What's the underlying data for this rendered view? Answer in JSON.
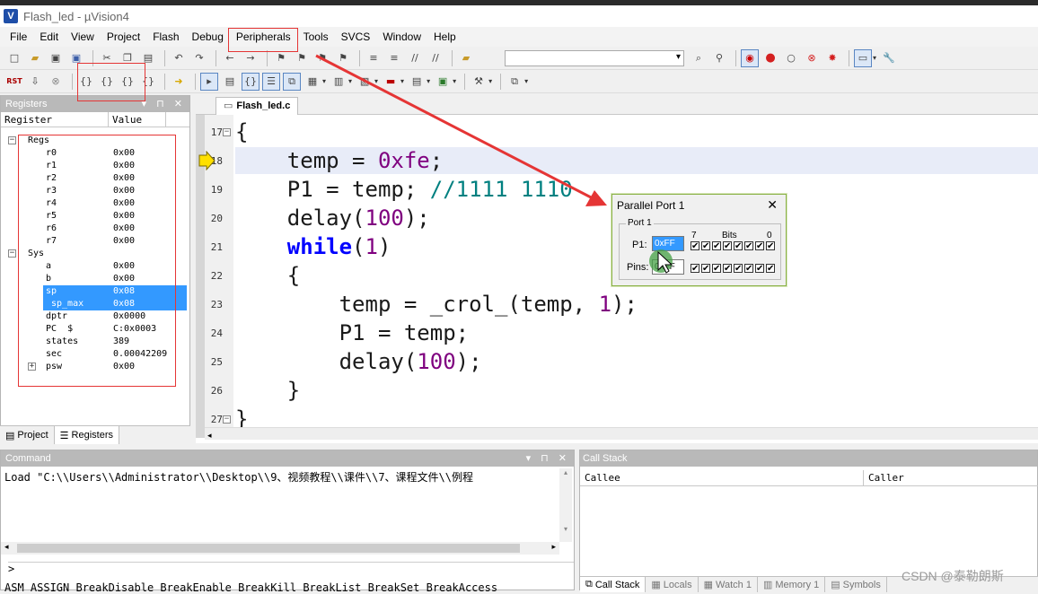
{
  "window": {
    "title": "Flash_led  -  µVision4",
    "app_icon_letter": "V"
  },
  "menu": [
    "File",
    "Edit",
    "View",
    "Project",
    "Flash",
    "Debug",
    "Peripherals",
    "Tools",
    "SVCS",
    "Window",
    "Help"
  ],
  "debug_toolbar": {
    "rst_label": "RST",
    "step_buttons": [
      "{}",
      "{}",
      "{}",
      "{}"
    ]
  },
  "registers_panel": {
    "title": "Registers",
    "columns": [
      "Register",
      "Value"
    ],
    "groups": [
      {
        "name": "Regs",
        "rows": [
          [
            "r0",
            "0x00"
          ],
          [
            "r1",
            "0x00"
          ],
          [
            "r2",
            "0x00"
          ],
          [
            "r3",
            "0x00"
          ],
          [
            "r4",
            "0x00"
          ],
          [
            "r5",
            "0x00"
          ],
          [
            "r6",
            "0x00"
          ],
          [
            "r7",
            "0x00"
          ]
        ]
      },
      {
        "name": "Sys",
        "rows": [
          [
            "a",
            "0x00"
          ],
          [
            "b",
            "0x00"
          ],
          [
            "sp",
            "0x08"
          ],
          [
            "sp_max",
            "0x08"
          ],
          [
            "dptr",
            "0x0000"
          ],
          [
            "PC  $",
            "C:0x0003"
          ],
          [
            "states",
            "389"
          ],
          [
            "sec",
            "0.00042209"
          ],
          [
            "psw",
            "0x00"
          ]
        ]
      }
    ],
    "selected": [
      "sp",
      "sp_max"
    ],
    "tabs": [
      "Project",
      "Registers"
    ],
    "active_tab": "Registers"
  },
  "editor": {
    "tab": "Flash_led.c",
    "current_line": 18,
    "lines": [
      {
        "n": "17",
        "code": "{"
      },
      {
        "n": "18",
        "code": "temp = 0xfe;"
      },
      {
        "n": "19",
        "code": "P1 = temp; //1111 1110"
      },
      {
        "n": "20",
        "code": "delay(100);"
      },
      {
        "n": "21",
        "code": "while(1)"
      },
      {
        "n": "22",
        "code": "{"
      },
      {
        "n": "23",
        "code": "temp = _crol_(temp, 1);"
      },
      {
        "n": "24",
        "code": "P1 = temp;"
      },
      {
        "n": "25",
        "code": "delay(100);"
      },
      {
        "n": "26",
        "code": "}"
      },
      {
        "n": "27",
        "code": "}"
      }
    ]
  },
  "parallel_port_dialog": {
    "title": "Parallel Port 1",
    "group": "Port 1",
    "p1_label": "P1:",
    "p1_value": "0xFF",
    "pins_label": "Pins:",
    "pins_value": "0xFF",
    "bits_label": "Bits",
    "bit_high": "7",
    "bit_low": "0",
    "p1_bits": [
      1,
      1,
      1,
      1,
      1,
      1,
      1,
      1
    ],
    "pins_bits": [
      1,
      1,
      1,
      1,
      1,
      1,
      1,
      1
    ]
  },
  "command_panel": {
    "title": "Command",
    "output": "Load \"C:\\\\Users\\\\Administrator\\\\Desktop\\\\9、视频教程\\\\课件\\\\7、课程文件\\\\例程",
    "prompt": ">",
    "hint": "ASM ASSIGN BreakDisable BreakEnable BreakKill BreakList BreakSet BreakAccess"
  },
  "callstack_panel": {
    "title": "Call Stack",
    "columns": [
      "Callee",
      "Caller"
    ],
    "tabs": [
      "Call Stack",
      "Locals",
      "Watch 1",
      "Memory 1",
      "Symbols"
    ]
  },
  "watermark": "CSDN @泰勒朗斯",
  "colors": {
    "selection": "#3399ff",
    "keyword": "#0000ff",
    "number": "#7f007f",
    "comment": "#008080",
    "annotation": "#e53535",
    "current_line": "#e8ecf8"
  }
}
